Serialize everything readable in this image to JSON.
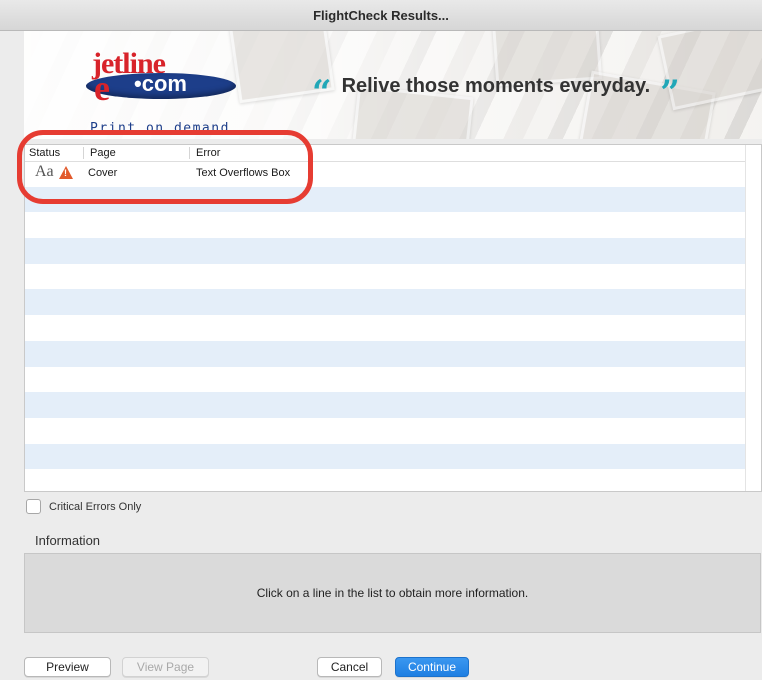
{
  "window": {
    "title": "FlightCheck Results..."
  },
  "banner": {
    "logo_word": "jetline",
    "logo_e": "e",
    "logo_dotcom": "•com",
    "logo_tagline": "Print on demand",
    "open_quote": "“",
    "slogan": "Relive those moments everyday.",
    "close_quote": "”"
  },
  "list": {
    "columns": {
      "status": "Status",
      "page": "Page",
      "error": "Error"
    },
    "rows": [
      {
        "status_text": "Aa",
        "status_icon": "warning-triangle-icon",
        "page": "Cover",
        "error": "Text Overflows Box"
      }
    ],
    "empty_rows": 12
  },
  "options": {
    "critical_errors_only": "Critical Errors Only"
  },
  "information": {
    "label": "Information",
    "message": "Click on a line in the list to obtain more information."
  },
  "buttons": {
    "preview": "Preview",
    "view_page": "View Page",
    "cancel": "Cancel",
    "continue": "Continue"
  },
  "colors": {
    "accent_blue": "#1f7fe2",
    "row_stripe": "#e4eef9",
    "highlight_red": "#e63c32",
    "logo_red": "#d8232a",
    "logo_blue": "#1d3e8a",
    "quote_teal": "#21a7b7"
  }
}
